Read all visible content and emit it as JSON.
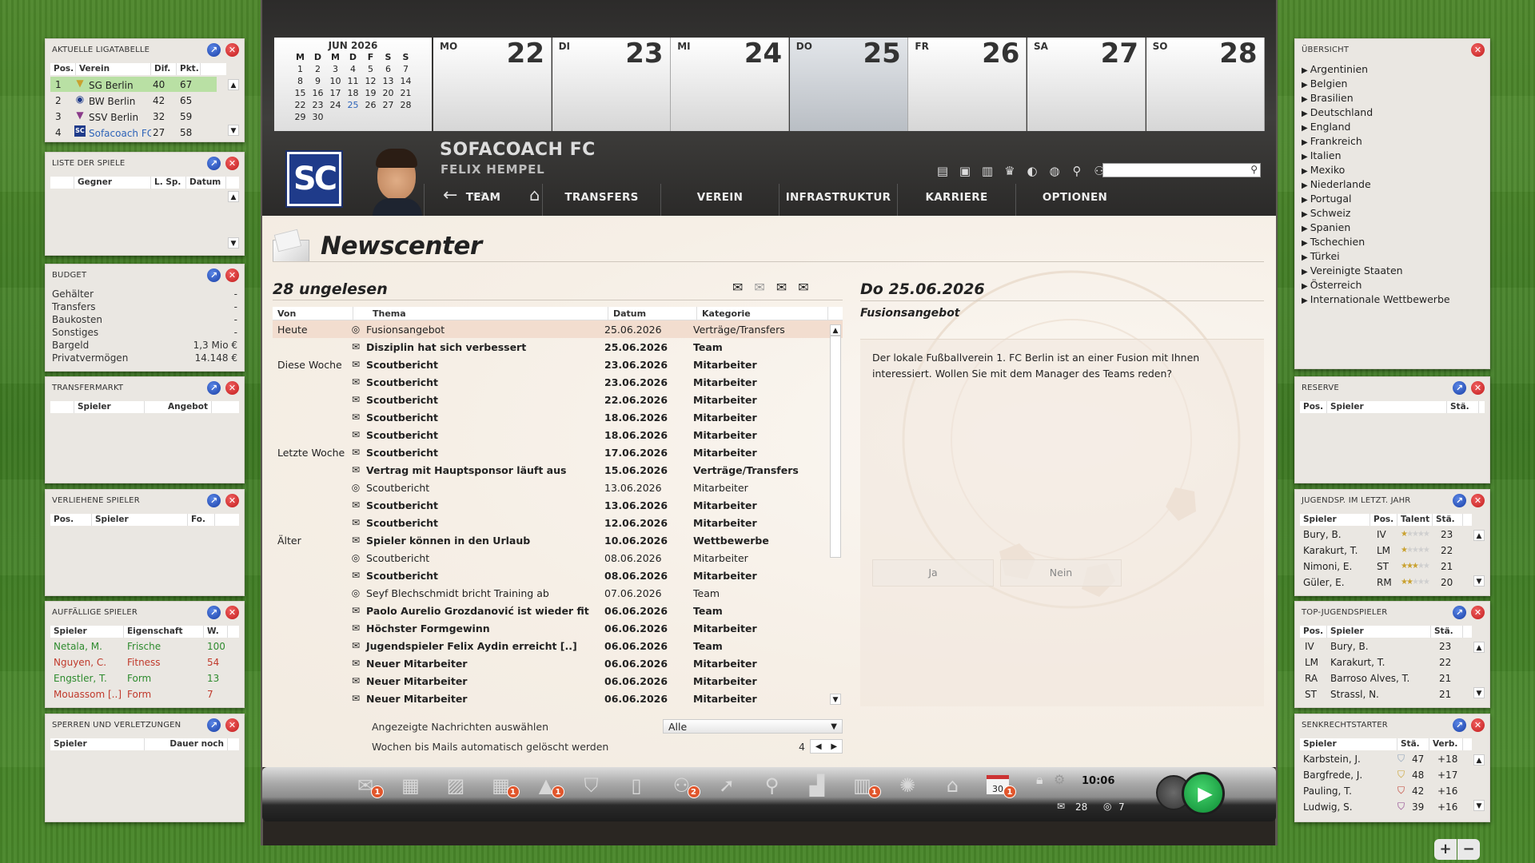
{
  "left_panels": {
    "league": {
      "title": "Aktuelle Ligatabelle",
      "headers": [
        "Pos.",
        "Verein",
        "Dif.",
        "Pkt."
      ],
      "rows": [
        {
          "pos": "1",
          "club": "SG Berlin",
          "dif": "40",
          "pkt": "67"
        },
        {
          "pos": "2",
          "club": "BW Berlin",
          "dif": "42",
          "pkt": "65"
        },
        {
          "pos": "3",
          "club": "SSV Berlin",
          "dif": "32",
          "pkt": "59"
        },
        {
          "pos": "4",
          "club": "Sofacoach FC",
          "dif": "27",
          "pkt": "58"
        }
      ]
    },
    "matches": {
      "title": "Liste der Spiele",
      "headers": [
        "Gegner",
        "L. Sp.",
        "Datum"
      ]
    },
    "budget": {
      "title": "Budget",
      "rows": [
        {
          "label": "Gehälter",
          "value": "-"
        },
        {
          "label": "Transfers",
          "value": "-"
        },
        {
          "label": "Baukosten",
          "value": "-"
        },
        {
          "label": "Sonstiges",
          "value": "-"
        },
        {
          "label": "Bargeld",
          "value": "1,3 Mio €"
        },
        {
          "label": "Privatvermögen",
          "value": "14.148 €"
        }
      ]
    },
    "transfer": {
      "title": "Transfermarkt",
      "headers": [
        "Spieler",
        "Angebot"
      ]
    },
    "loaned": {
      "title": "Verliehene Spieler",
      "headers": [
        "Pos.",
        "Spieler",
        "Fo."
      ]
    },
    "notable": {
      "title": "Auffällige Spieler",
      "headers": [
        "Spieler",
        "Eigenschaft",
        "W."
      ],
      "rows": [
        {
          "name": "Netala, M.",
          "prop": "Frische",
          "val": "100",
          "color": "#2e8b2e"
        },
        {
          "name": "Nguyen, C.",
          "prop": "Fitness",
          "val": "54",
          "color": "#c0392b"
        },
        {
          "name": "Engstler, T.",
          "prop": "Form",
          "val": "13",
          "color": "#2e8b2e"
        },
        {
          "name": "Mouassom [..]",
          "prop": "Form",
          "val": "7",
          "color": "#c0392b"
        }
      ]
    },
    "bans": {
      "title": "Sperren und Verletzungen",
      "headers": [
        "Spieler",
        "Dauer noch"
      ]
    }
  },
  "calendar": {
    "mini_title": "JUN 2026",
    "weekday_heads": [
      "M",
      "D",
      "M",
      "D",
      "F",
      "S",
      "S"
    ],
    "mini_days": [
      "1",
      "2",
      "3",
      "4",
      "5",
      "6",
      "7",
      "8",
      "9",
      "10",
      "11",
      "12",
      "13",
      "14",
      "15",
      "16",
      "17",
      "18",
      "19",
      "20",
      "21",
      "22",
      "23",
      "24",
      "25",
      "26",
      "27",
      "28",
      "29",
      "30"
    ],
    "days": [
      {
        "dn": "MO",
        "num": "22"
      },
      {
        "dn": "DI",
        "num": "23"
      },
      {
        "dn": "MI",
        "num": "24"
      },
      {
        "dn": "DO",
        "num": "25"
      },
      {
        "dn": "FR",
        "num": "26"
      },
      {
        "dn": "SA",
        "num": "27"
      },
      {
        "dn": "SO",
        "num": "28"
      }
    ]
  },
  "club": {
    "logo": "SC",
    "name": "SOFACOACH FC",
    "manager": "FELIX HEMPEL"
  },
  "nav": {
    "items": [
      "TEAM",
      "TRANSFERS",
      "VEREIN",
      "INFRASTRUKTUR",
      "KARRIERE",
      "OPTIONEN"
    ]
  },
  "newscenter": {
    "title": "Newscenter",
    "unread": "28 ungelesen",
    "headers": [
      "Von",
      "Thema",
      "Datum",
      "Kategorie"
    ],
    "messages": [
      {
        "group": "Heute",
        "icon": "◎",
        "topic": "Fusionsangebot",
        "date": "25.06.2026",
        "cat": "Verträge/Transfers",
        "bold": false,
        "sel": true
      },
      {
        "group": "",
        "icon": "✉",
        "topic": "Disziplin hat sich verbessert",
        "date": "25.06.2026",
        "cat": "Team",
        "bold": true
      },
      {
        "group": "Diese Woche",
        "icon": "✉",
        "topic": "Scoutbericht",
        "date": "23.06.2026",
        "cat": "Mitarbeiter",
        "bold": true
      },
      {
        "group": "",
        "icon": "✉",
        "topic": "Scoutbericht",
        "date": "23.06.2026",
        "cat": "Mitarbeiter",
        "bold": true
      },
      {
        "group": "",
        "icon": "✉",
        "topic": "Scoutbericht",
        "date": "22.06.2026",
        "cat": "Mitarbeiter",
        "bold": true
      },
      {
        "group": "",
        "icon": "✉",
        "topic": "Scoutbericht",
        "date": "18.06.2026",
        "cat": "Mitarbeiter",
        "bold": true
      },
      {
        "group": "",
        "icon": "✉",
        "topic": "Scoutbericht",
        "date": "18.06.2026",
        "cat": "Mitarbeiter",
        "bold": true
      },
      {
        "group": "Letzte Woche",
        "icon": "✉",
        "topic": "Scoutbericht",
        "date": "17.06.2026",
        "cat": "Mitarbeiter",
        "bold": true
      },
      {
        "group": "",
        "icon": "✉",
        "topic": "Vertrag mit Hauptsponsor läuft aus",
        "date": "15.06.2026",
        "cat": "Verträge/Transfers",
        "bold": true
      },
      {
        "group": "",
        "icon": "◎",
        "topic": "Scoutbericht",
        "date": "13.06.2026",
        "cat": "Mitarbeiter",
        "bold": false
      },
      {
        "group": "",
        "icon": "✉",
        "topic": "Scoutbericht",
        "date": "13.06.2026",
        "cat": "Mitarbeiter",
        "bold": true
      },
      {
        "group": "",
        "icon": "✉",
        "topic": "Scoutbericht",
        "date": "12.06.2026",
        "cat": "Mitarbeiter",
        "bold": true
      },
      {
        "group": "Älter",
        "icon": "✉",
        "topic": "Spieler können in den Urlaub",
        "date": "10.06.2026",
        "cat": "Wettbewerbe",
        "bold": true
      },
      {
        "group": "",
        "icon": "◎",
        "topic": "Scoutbericht",
        "date": "08.06.2026",
        "cat": "Mitarbeiter",
        "bold": false
      },
      {
        "group": "",
        "icon": "✉",
        "topic": "Scoutbericht",
        "date": "08.06.2026",
        "cat": "Mitarbeiter",
        "bold": true
      },
      {
        "group": "",
        "icon": "◎",
        "topic": "Seyf Blechschmidt bricht Training ab",
        "date": "07.06.2026",
        "cat": "Team",
        "bold": false
      },
      {
        "group": "",
        "icon": "✉",
        "topic": "Paolo Aurelio Grozdanović ist wieder fit",
        "date": "06.06.2026",
        "cat": "Team",
        "bold": true
      },
      {
        "group": "",
        "icon": "✉",
        "topic": "Höchster Formgewinn",
        "date": "06.06.2026",
        "cat": "Mitarbeiter",
        "bold": true
      },
      {
        "group": "",
        "icon": "✉",
        "topic": "Jugendspieler Felix Aydin erreicht [..]",
        "date": "06.06.2026",
        "cat": "Team",
        "bold": true
      },
      {
        "group": "",
        "icon": "✉",
        "topic": "Neuer Mitarbeiter",
        "date": "06.06.2026",
        "cat": "Mitarbeiter",
        "bold": true
      },
      {
        "group": "",
        "icon": "✉",
        "topic": "Neuer Mitarbeiter",
        "date": "06.06.2026",
        "cat": "Mitarbeiter",
        "bold": true
      },
      {
        "group": "",
        "icon": "✉",
        "topic": "Neuer Mitarbeiter",
        "date": "06.06.2026",
        "cat": "Mitarbeiter",
        "bold": true
      }
    ],
    "filter_label": "Angezeigte Nachrichten auswählen",
    "filter_value": "Alle",
    "weeks_label": "Wochen bis Mails automatisch gelöscht werden",
    "weeks_value": "4",
    "detail": {
      "date": "Do 25.06.2026",
      "subject": "Fusionsangebot",
      "body": "Der lokale Fußballverein 1. FC Berlin ist an einer Fusion mit Ihnen interessiert. Wollen Sie mit dem Manager des Teams reden?",
      "yes": "Ja",
      "no": "Nein"
    }
  },
  "overview": {
    "title": "Übersicht",
    "items": [
      "Argentinien",
      "Belgien",
      "Brasilien",
      "Deutschland",
      "England",
      "Frankreich",
      "Italien",
      "Mexiko",
      "Niederlande",
      "Portugal",
      "Schweiz",
      "Spanien",
      "Tschechien",
      "Türkei",
      "Vereinigte Staaten",
      "Österreich",
      "Internationale Wettbewerbe"
    ]
  },
  "right_panels": {
    "reserve": {
      "title": "Reserve",
      "headers": [
        "Pos.",
        "Spieler",
        "Stä."
      ]
    },
    "youth_last": {
      "title": "Jugendsp. im letzt. Jahr",
      "headers": [
        "Spieler",
        "Pos.",
        "Talent",
        "Stä."
      ],
      "rows": [
        {
          "name": "Bury, B.",
          "pos": "IV",
          "talent": 1,
          "sta": "23"
        },
        {
          "name": "Karakurt, T.",
          "pos": "LM",
          "talent": 1,
          "sta": "22"
        },
        {
          "name": "Nimoni, E.",
          "pos": "ST",
          "talent": 3,
          "sta": "21"
        },
        {
          "name": "Güler, E.",
          "pos": "RM",
          "talent": 2,
          "sta": "20"
        }
      ]
    },
    "top_youth": {
      "title": "Top-Jugendspieler",
      "headers": [
        "Pos.",
        "Spieler",
        "Stä."
      ],
      "rows": [
        {
          "pos": "IV",
          "name": "Bury, B.",
          "sta": "23"
        },
        {
          "pos": "LM",
          "name": "Karakurt, T.",
          "sta": "22"
        },
        {
          "pos": "RA",
          "name": "Barroso Alves, T.",
          "sta": "21"
        },
        {
          "pos": "ST",
          "name": "Strassl, N.",
          "sta": "21"
        }
      ]
    },
    "risers": {
      "title": "Senkrechtstarter",
      "headers": [
        "Spieler",
        "Stä.",
        "Verb."
      ],
      "rows": [
        {
          "name": "Karbstein, J.",
          "sta": "47",
          "verb": "+18"
        },
        {
          "name": "Bargfrede, J.",
          "sta": "48",
          "verb": "+17"
        },
        {
          "name": "Pauling, T.",
          "sta": "42",
          "verb": "+16"
        },
        {
          "name": "Ludwig, S.",
          "sta": "39",
          "verb": "+16"
        }
      ]
    }
  },
  "toolbar": {
    "time": "10:06",
    "mail_count": "28",
    "chat_count": "7",
    "calendar_day": "30",
    "badges": [
      "1",
      "1",
      "1",
      "2",
      "1",
      "1"
    ]
  },
  "zoom": {
    "plus": "+",
    "minus": "−"
  }
}
